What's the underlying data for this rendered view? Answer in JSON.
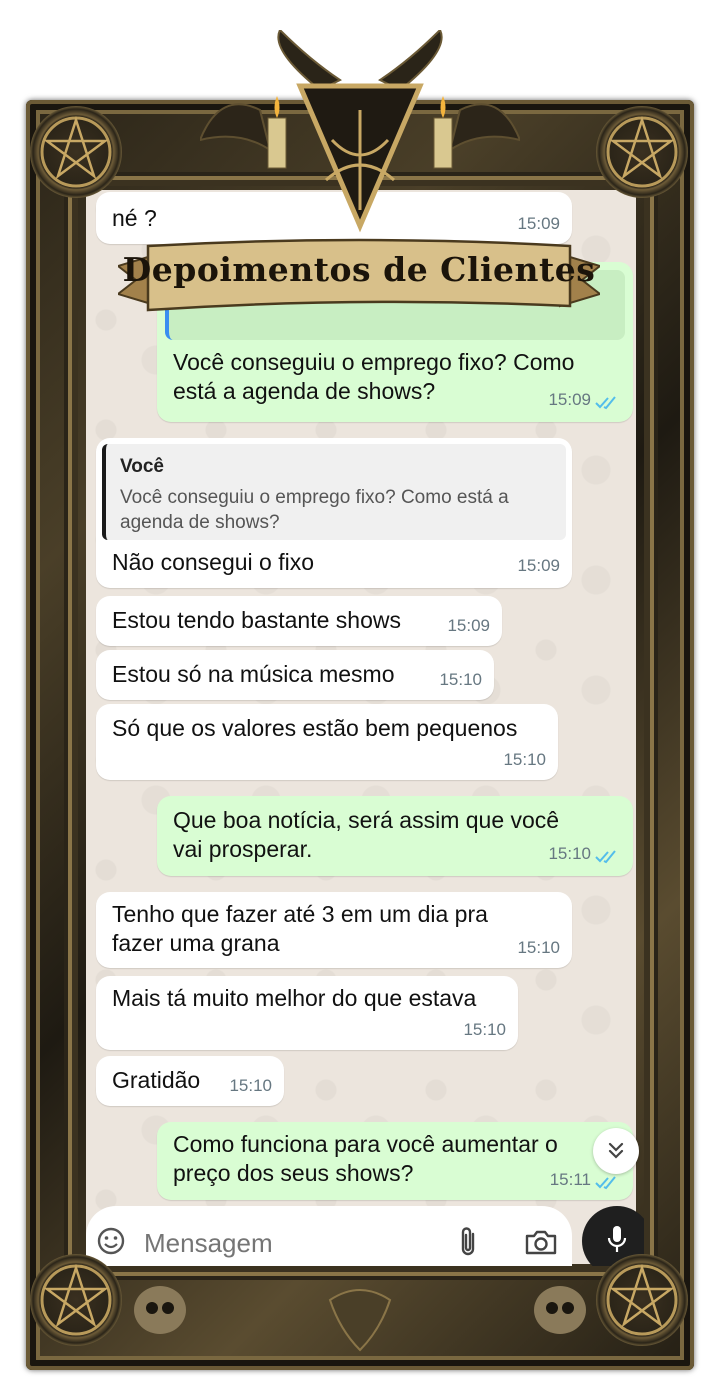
{
  "banner": {
    "title": "Depoimentos de Clientes"
  },
  "messages": [
    {
      "text": "né ?",
      "time": "15:09",
      "dir": "in"
    },
    {
      "text": "Você conseguiu o emprego  fixo? Como está a agenda de shows?",
      "time": "15:09",
      "dir": "out",
      "read": true
    },
    {
      "quote_author": "Você",
      "quote_text": "Você conseguiu o emprego  fixo? Como está a agenda de shows?",
      "text": "Não consegui o fixo",
      "time": "15:09",
      "dir": "in"
    },
    {
      "text": "Estou tendo bastante shows",
      "time": "15:09",
      "dir": "in"
    },
    {
      "text": "Estou só na música mesmo",
      "time": "15:10",
      "dir": "in"
    },
    {
      "text": "Só que os valores estão bem pequenos",
      "time": "15:10",
      "dir": "in"
    },
    {
      "text": "Que boa notícia, será assim que você vai prosperar.",
      "time": "15:10",
      "dir": "out",
      "read": true
    },
    {
      "text": "Tenho que fazer até 3 em um dia pra fazer uma grana",
      "time": "15:10",
      "dir": "in"
    },
    {
      "text": "Mais tá muito melhor do que estava",
      "time": "15:10",
      "dir": "in"
    },
    {
      "text": "Gratidão",
      "time": "15:10",
      "dir": "in"
    },
    {
      "text": "Como funciona para você aumentar o preço dos seus shows?",
      "time": "15:11",
      "dir": "out",
      "read": true
    }
  ],
  "input": {
    "placeholder": "Mensagem"
  },
  "icons": {
    "emoji": "emoji-icon",
    "attach": "paperclip-icon",
    "camera": "camera-icon",
    "mic": "mic-icon",
    "scroll": "chevrons-down-icon",
    "read": "double-check-icon"
  },
  "colors": {
    "incoming": "#ffffff",
    "outgoing": "#d9fdd3",
    "tick": "#53bdeb",
    "chat_bg": "#ece5dd"
  }
}
